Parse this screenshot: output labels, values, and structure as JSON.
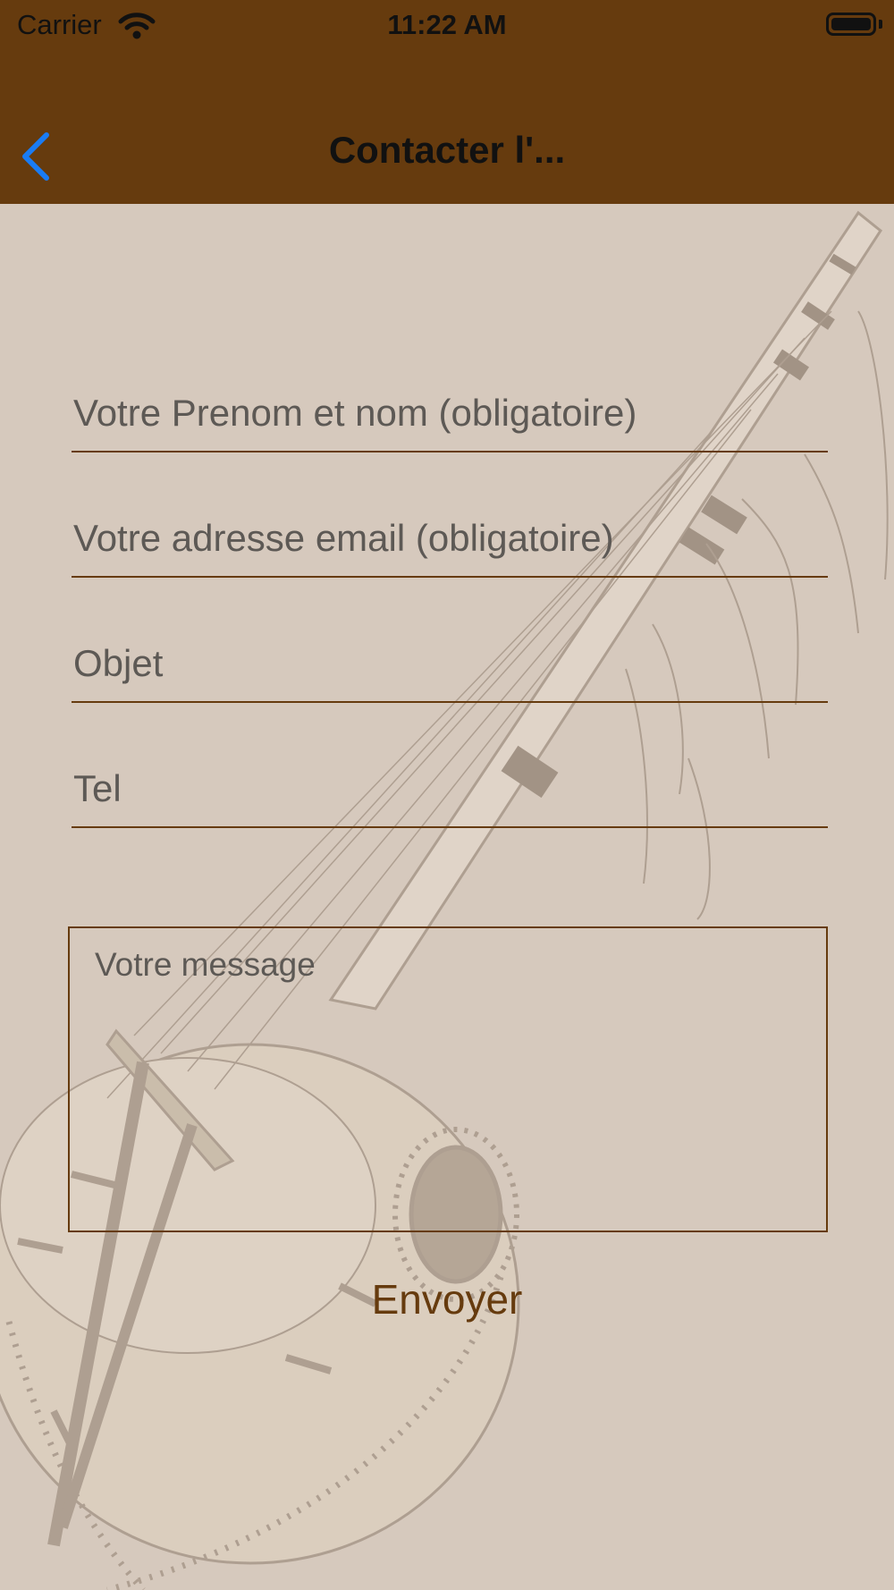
{
  "status_bar": {
    "carrier": "Carrier",
    "time": "11:22 AM",
    "wifi_icon": "wifi-icon",
    "battery_icon": "battery-icon"
  },
  "nav": {
    "title": "Contacter l'...",
    "back_icon": "chevron-left-icon"
  },
  "form": {
    "name_placeholder": "Votre Prenom et nom (obligatoire)",
    "email_placeholder": "Votre adresse email (obligatoire)",
    "subject_placeholder": "Objet",
    "phone_placeholder": "Tel",
    "message_placeholder": "Votre message",
    "send_label": "Envoyer"
  },
  "background": {
    "illustration": "kora-instrument-sketch"
  },
  "colors": {
    "nav_background": "#663b0e",
    "page_background": "#d6c9bd",
    "accent": "#663b0e",
    "back_icon": "#1a7cf4"
  }
}
